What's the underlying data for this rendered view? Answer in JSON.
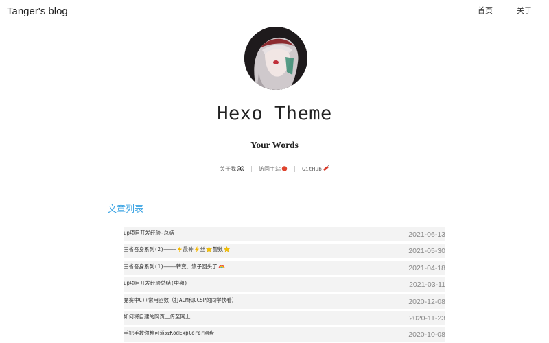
{
  "header": {
    "brand": "Tanger's blog",
    "nav": [
      "首页",
      "关于"
    ]
  },
  "profile": {
    "title": "Hexo Theme",
    "subtitle": "Your Words",
    "links": [
      {
        "label": "关于我",
        "icon": "eyes-emoji"
      },
      {
        "label": "访问主站",
        "icon": "tomato-emoji"
      },
      {
        "label": "GitHub",
        "icon": "firecracker-emoji"
      }
    ]
  },
  "section_title": "文章列表",
  "posts": [
    {
      "title": "up项目开发经验-总结",
      "date": "2021-06-13"
    },
    {
      "title": "三省吾身系列(2)————",
      "title_mid": "晨钟",
      "title_mid2": "丝",
      "title_end": "警数",
      "date": "2021-05-30"
    },
    {
      "title": "三省吾身系列(1)————转变、浪子回头了",
      "date": "2021-04-18"
    },
    {
      "title": "up项目开发经验总结(中期)",
      "date": "2021-03-11"
    },
    {
      "title": "竞赛中C++常用函数（打ACM和CCSP的同学快看）",
      "date": "2020-12-08"
    },
    {
      "title": "如何将自建的网页上传至网上",
      "date": "2020-11-23"
    },
    {
      "title": "手把手教你整可道云KodExplorer网盘",
      "date": "2020-10-08"
    }
  ]
}
